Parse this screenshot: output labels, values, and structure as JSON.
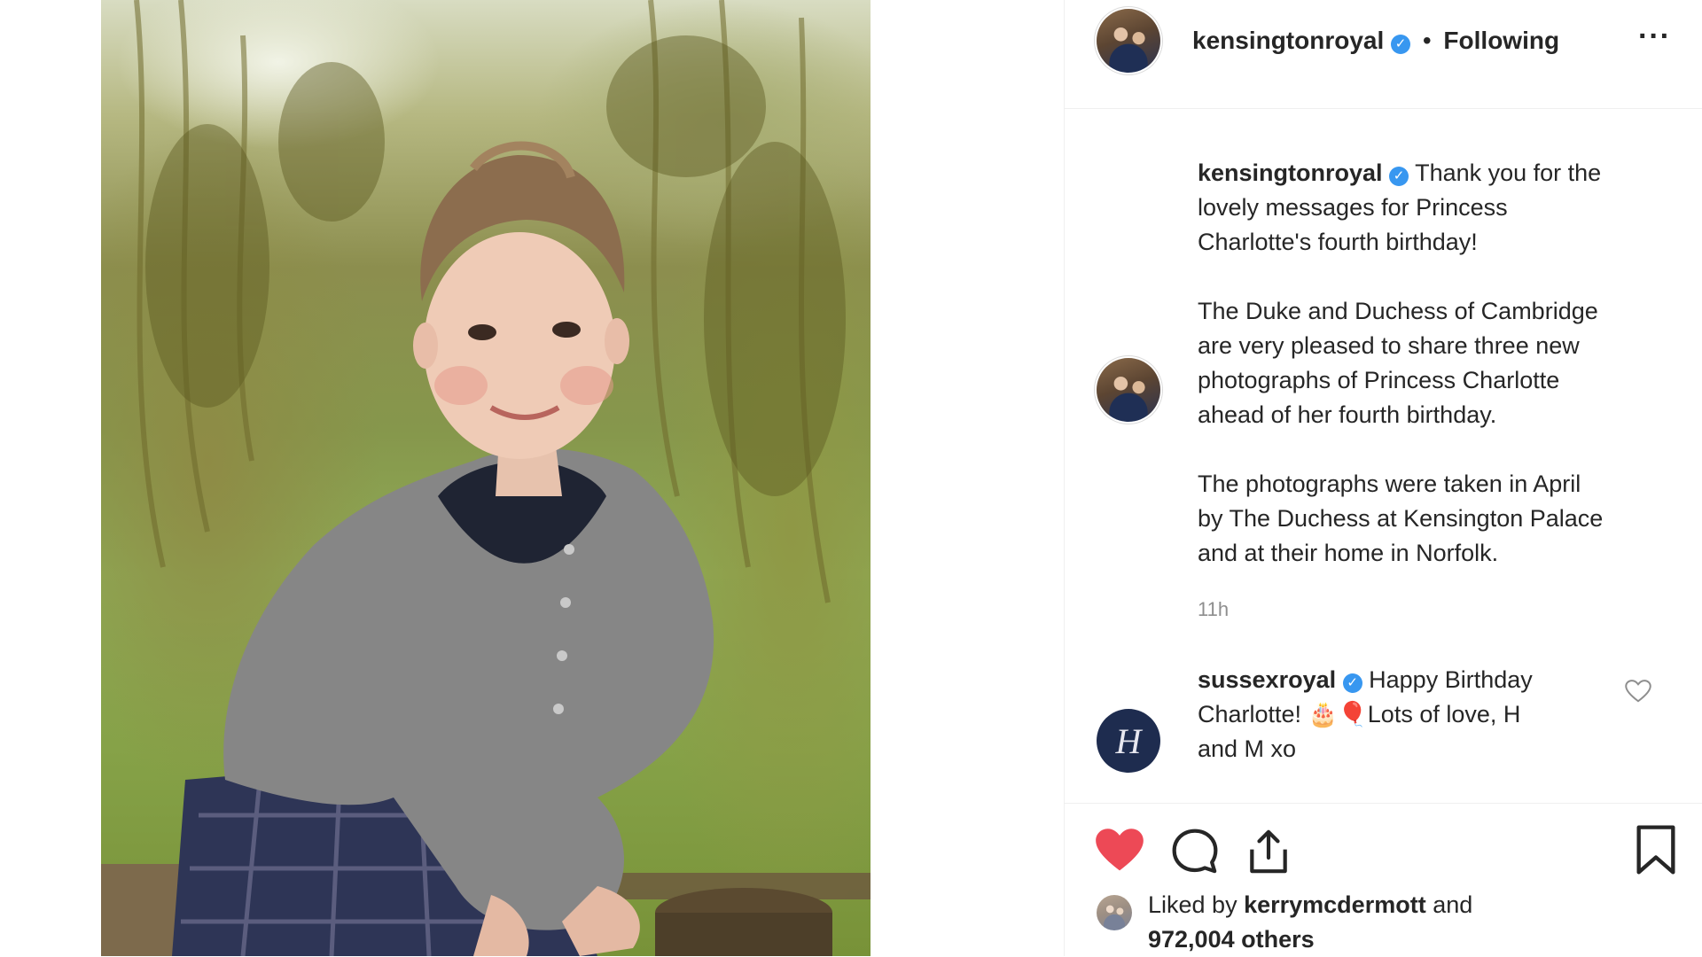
{
  "post": {
    "photo": {
      "subject": "young girl in a grey cardigan and plaid skirt leaning on a wooden fence post, willow trees and green grass behind"
    },
    "header": {
      "username": "kensingtonroyal",
      "verified_glyph": "✓",
      "separator": "•",
      "follow_status": "Following",
      "more_glyph": "···"
    },
    "caption": {
      "username": "kensingtonroyal",
      "paragraphs": [
        "Thank you for the lovely messages for Princess Charlotte's fourth birthday!",
        "The Duke and Duchess of Cambridge are very pleased to share three new photographs of Princess Charlotte ahead of her fourth birthday.",
        "The photographs were taken in April by The Duchess at Kensington Palace and at their home in Norfolk."
      ],
      "lines_1": [
        "Thank you for the",
        "lovely messages for Princess",
        "Charlotte's fourth birthday!"
      ],
      "lines_2": [
        "The Duke and Duchess of Cambridge",
        "are very pleased to share three new",
        "photographs of Princess Charlotte",
        "ahead of her fourth birthday."
      ],
      "lines_3": [
        "The photographs were taken in April",
        "by The Duchess at Kensington Palace",
        "and at their home in Norfolk."
      ],
      "timestamp": "11h"
    },
    "comment": {
      "username": "sussexroyal",
      "text_line_1": "Happy Birthday",
      "text_line_2": "Charlotte! 🎂🎈Lots of love, H",
      "text_line_3": "and M xo",
      "avatar_monogram": "H"
    },
    "likes": {
      "prefix": "Liked by",
      "user": "kerrymcdermott",
      "suffix_1": "and",
      "suffix_2": "972,004 others"
    },
    "icons": [
      "heart-filled-icon",
      "comment-icon",
      "share-icon",
      "bookmark-icon",
      "heart-outline-icon",
      "more-icon",
      "verified-icon"
    ],
    "colors": {
      "like_red": "#ed4956",
      "verified_blue": "#3897f0",
      "text": "#262626",
      "muted": "#8e8e8e",
      "divider": "#efefef"
    }
  }
}
